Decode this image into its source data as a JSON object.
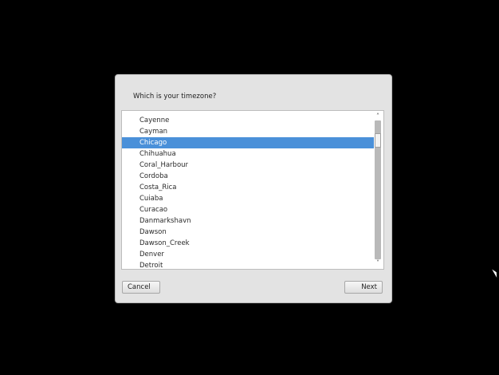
{
  "dialog": {
    "title": "Which is your timezone?",
    "timezones": [
      "Cayenne",
      "Cayman",
      "Chicago",
      "Chihuahua",
      "Coral_Harbour",
      "Cordoba",
      "Costa_Rica",
      "Cuiaba",
      "Curacao",
      "Danmarkshavn",
      "Dawson",
      "Dawson_Creek",
      "Denver",
      "Detroit"
    ],
    "selected_timezone": "Chicago",
    "cancel_label": "Cancel",
    "next_label": "Next"
  },
  "scrollbar": {
    "up_icon": "chevron-up-icon",
    "down_icon": "chevron-down-icon",
    "position_fraction": 0.1
  },
  "colors": {
    "selection": "#4a90d9",
    "background": "#000000",
    "dialog": "#e3e3e3"
  }
}
